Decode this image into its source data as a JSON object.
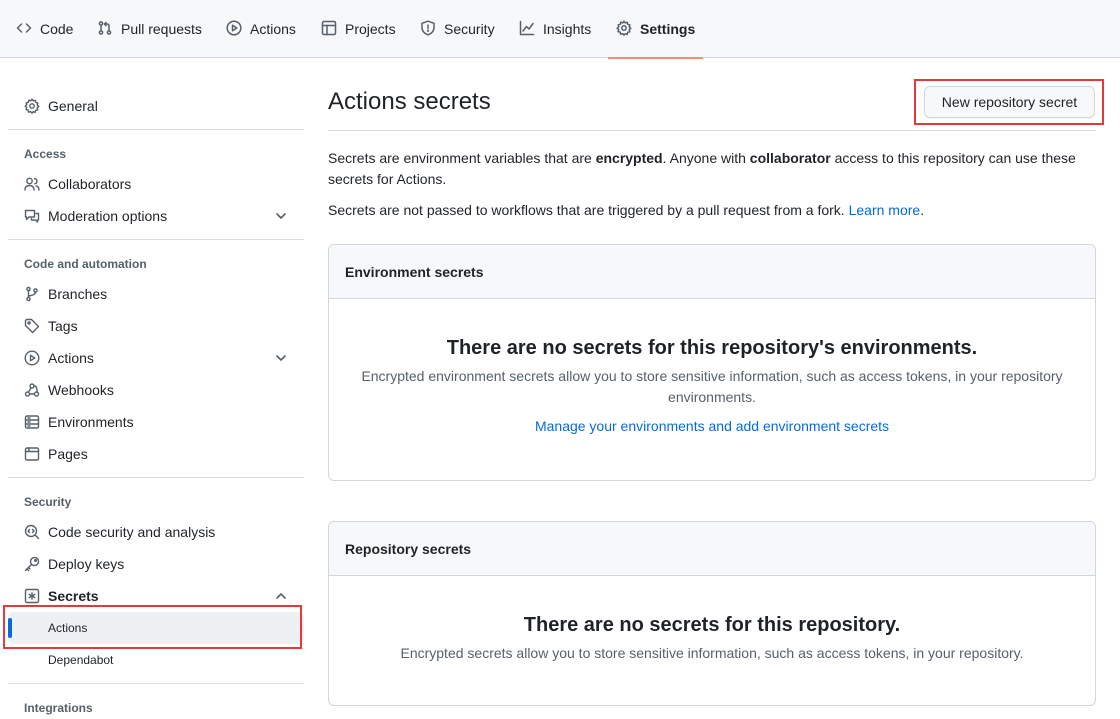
{
  "topnav": {
    "tabs": [
      {
        "label": "Code",
        "icon": "code-icon"
      },
      {
        "label": "Pull requests",
        "icon": "git-pull-request-icon"
      },
      {
        "label": "Actions",
        "icon": "play-icon"
      },
      {
        "label": "Projects",
        "icon": "table-icon"
      },
      {
        "label": "Security",
        "icon": "shield-icon"
      },
      {
        "label": "Insights",
        "icon": "graph-icon"
      },
      {
        "label": "Settings",
        "icon": "gear-icon",
        "selected": true
      }
    ]
  },
  "sidebar": {
    "general": "General",
    "access_heading": "Access",
    "collaborators": "Collaborators",
    "moderation": "Moderation options",
    "code_automation_heading": "Code and automation",
    "branches": "Branches",
    "tags": "Tags",
    "actions": "Actions",
    "webhooks": "Webhooks",
    "environments": "Environments",
    "pages": "Pages",
    "security_heading": "Security",
    "code_security": "Code security and analysis",
    "deploy_keys": "Deploy keys",
    "secrets": "Secrets",
    "secrets_actions": "Actions",
    "secrets_dependabot": "Dependabot",
    "integrations_heading": "Integrations"
  },
  "main": {
    "title": "Actions secrets",
    "new_secret_button": "New repository secret",
    "intro": {
      "p1_a": "Secrets are environment variables that are ",
      "p1_b": "encrypted",
      "p1_c": ". Anyone with ",
      "p1_d": "collaborator",
      "p1_e": " access to this repository can use these secrets for Actions.",
      "p2_a": "Secrets are not passed to workflows that are triggered by a pull request from a fork. ",
      "p2_link": "Learn more",
      "p2_end": "."
    },
    "env_box": {
      "header": "Environment secrets",
      "blank_title": "There are no secrets for this repository's environments.",
      "blank_desc": "Encrypted environment secrets allow you to store sensitive information, such as access tokens, in your repository environments.",
      "link": "Manage your environments and add environment secrets"
    },
    "repo_box": {
      "header": "Repository secrets",
      "blank_title": "There are no secrets for this repository.",
      "blank_desc": "Encrypted secrets allow you to store sensitive information, such as access tokens, in your repository."
    }
  },
  "colors": {
    "link": "#0969da",
    "selected_underline": "#fd8c73",
    "highlight_box": "#e03a3a",
    "active_bar": "#0969da"
  }
}
